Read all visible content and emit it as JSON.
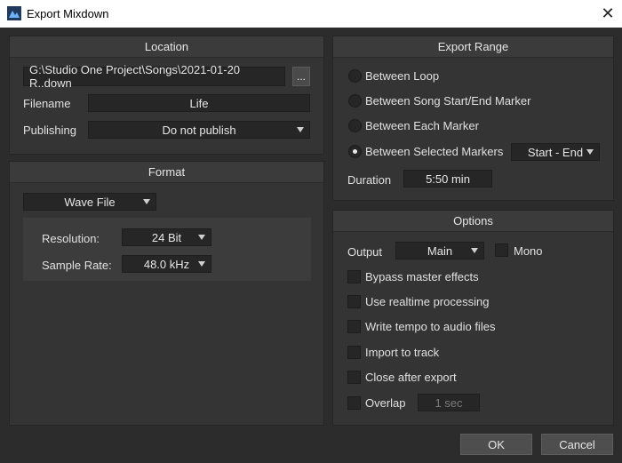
{
  "window": {
    "title": "Export Mixdown",
    "close_glyph": "✕"
  },
  "location": {
    "header": "Location",
    "path": "G:\\Studio One Project\\Songs\\2021-01-20 R..down",
    "browse_label": "...",
    "filename_label": "Filename",
    "filename_value": "Life",
    "publishing_label": "Publishing",
    "publishing_value": "Do not publish"
  },
  "format": {
    "header": "Format",
    "file_type": "Wave File",
    "resolution_label": "Resolution:",
    "resolution_value": "24 Bit",
    "sample_rate_label": "Sample Rate:",
    "sample_rate_value": "48.0 kHz"
  },
  "export_range": {
    "header": "Export Range",
    "options": [
      {
        "label": "Between Loop",
        "selected": false
      },
      {
        "label": "Between Song Start/End Marker",
        "selected": false
      },
      {
        "label": "Between Each Marker",
        "selected": false
      },
      {
        "label": "Between Selected Markers",
        "selected": true
      }
    ],
    "marker_select_value": "Start - End",
    "duration_label": "Duration",
    "duration_value": "5:50 min"
  },
  "options": {
    "header": "Options",
    "output_label": "Output",
    "output_value": "Main",
    "mono_label": "Mono",
    "checkboxes": [
      {
        "label": "Bypass master effects",
        "checked": false
      },
      {
        "label": "Use realtime processing",
        "checked": false
      },
      {
        "label": "Write tempo to audio files",
        "checked": false
      },
      {
        "label": "Import to track",
        "checked": false
      },
      {
        "label": "Close after export",
        "checked": false
      },
      {
        "label": "Overlap",
        "checked": false
      }
    ],
    "overlap_value": "1 sec"
  },
  "buttons": {
    "ok": "OK",
    "cancel": "Cancel"
  },
  "colors": {
    "background": "#2c2c2c",
    "panel": "#343434",
    "field": "#262626"
  }
}
